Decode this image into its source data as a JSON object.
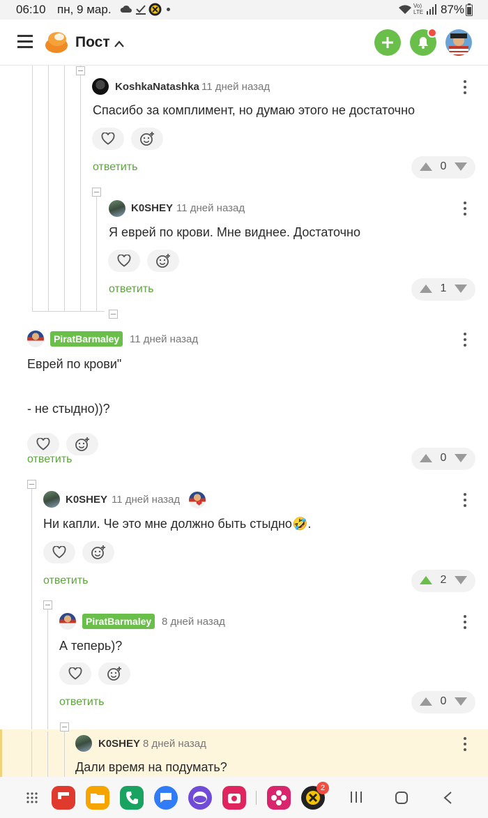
{
  "status_bar": {
    "time": "06:10",
    "date": "пн, 9 мар.",
    "battery": "87%"
  },
  "app_bar": {
    "title": "Пост",
    "menu_icon": "hamburger-icon",
    "add_icon": "plus-icon",
    "bell_icon": "bell-icon"
  },
  "comments": [
    {
      "id": "c1",
      "author": "KoshkaNatashka",
      "time": "11 дней назад",
      "text": "Спасибо за комплимент, но думаю этого не достаточно",
      "reply": "ответить",
      "rating": "0",
      "vote_active": false
    },
    {
      "id": "c2",
      "author": "K0SHEY",
      "time": "11 дней назад",
      "text": "Я еврей по крови. Мне виднее. Достаточно",
      "reply": "ответить",
      "rating": "1",
      "vote_active": false
    },
    {
      "id": "c3",
      "author": "PiratBarmaley",
      "time": "11 дней назад",
      "text_line1": "Еврей по крови\"",
      "text_line2": "- не стыдно))?",
      "reply": "ответить",
      "rating": "0",
      "vote_active": false
    },
    {
      "id": "c4",
      "author": "K0SHEY",
      "time": "11 дней назад",
      "text": "Ни капли. Че это мне должно быть стыдно🤣.",
      "reply": "ответить",
      "rating": "2",
      "vote_active": true
    },
    {
      "id": "c5",
      "author": "PiratBarmaley",
      "time": "8 дней назад",
      "text": "А теперь)?",
      "reply": "ответить",
      "rating": "0",
      "vote_active": false
    },
    {
      "id": "c6",
      "author": "K0SHEY",
      "time": "8 дней назад",
      "text": "Дали время на подумать?"
    }
  ],
  "nav_bar": {
    "notification_count": "2"
  },
  "colors": {
    "accent_green": "#6abf4b",
    "reply_green": "#5aa63a",
    "highlight_bg": "#fdf6dc",
    "notification_red": "#f04e3e"
  }
}
